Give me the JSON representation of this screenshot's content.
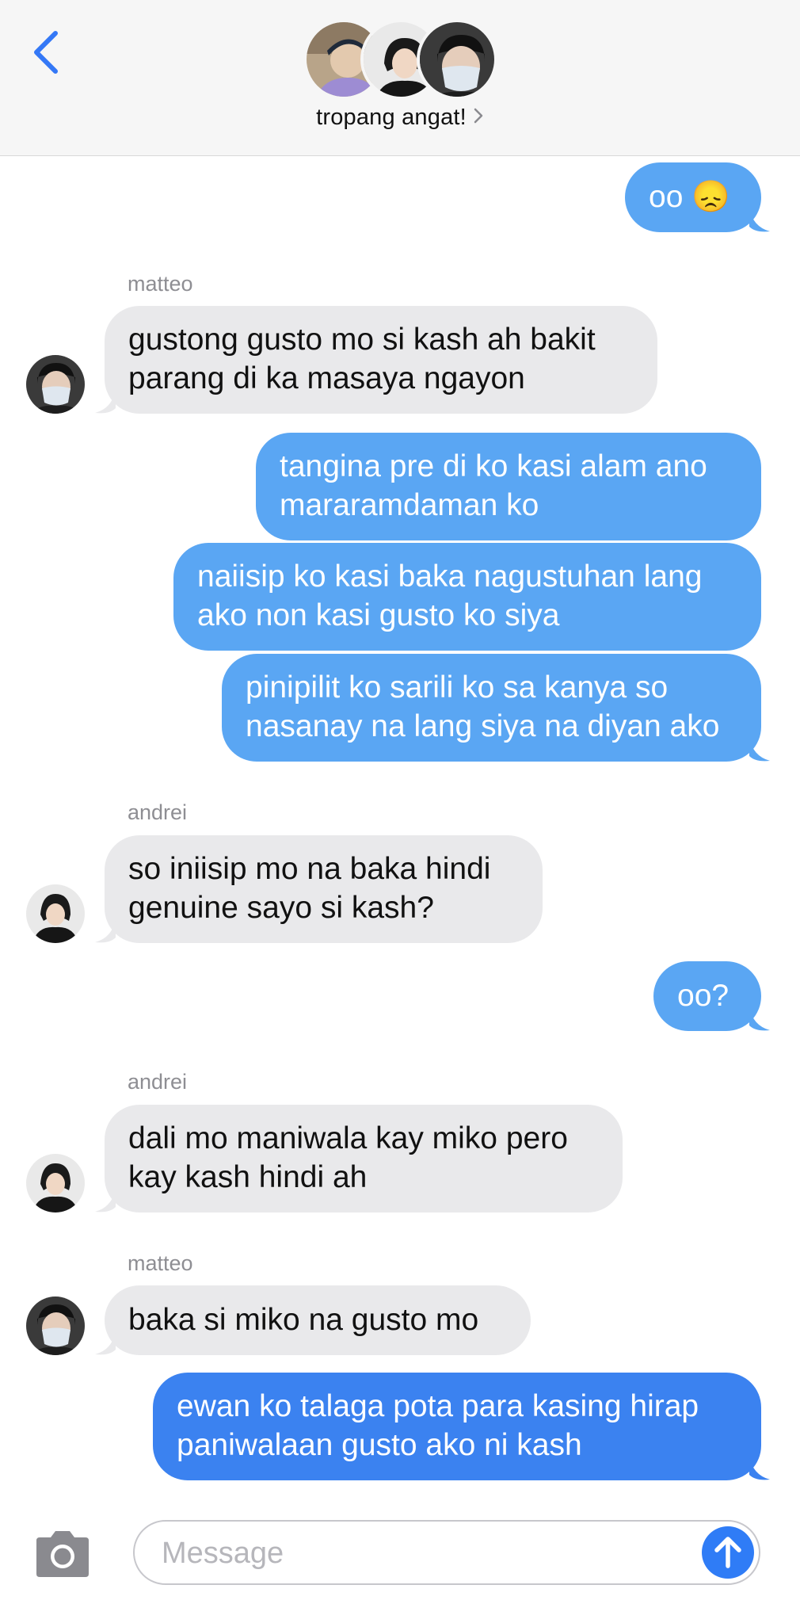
{
  "header": {
    "group_name": "tropang angat!",
    "back_icon": "chevron-left-icon",
    "accent": "#3478f6"
  },
  "messages": [
    {
      "dir": "out",
      "text": "oo 😞"
    },
    {
      "dir": "in",
      "sender": "matteo",
      "text": "gustong gusto mo si kash ah bakit\nparang di ka masaya ngayon"
    },
    {
      "dir": "out",
      "text": "tangina pre di ko kasi alam ano\nmararamdaman ko"
    },
    {
      "dir": "out",
      "text": "naiisip ko kasi baka nagustuhan lang\nako non kasi gusto ko siya"
    },
    {
      "dir": "out",
      "text": "pinipilit ko sarili ko sa kanya so\nnasanay na lang siya na diyan ako"
    },
    {
      "dir": "in",
      "sender": "andrei",
      "text": "so iniisip mo na baka hindi\ngenuine sayo si kash?"
    },
    {
      "dir": "out",
      "text": "oo?"
    },
    {
      "dir": "in",
      "sender": "andrei",
      "text": "dali mo maniwala kay miko pero\nkay kash hindi ah"
    },
    {
      "dir": "in",
      "sender": "matteo",
      "text": "baka si miko na gusto mo"
    },
    {
      "dir": "out",
      "text": "ewan ko talaga pota para kasing hirap\npaniwalaan gusto ako ni kash"
    }
  ],
  "composer": {
    "placeholder": "Message",
    "camera_icon": "camera-icon",
    "send_icon": "arrow-up-icon"
  },
  "colors": {
    "outgoing_bubble": "#5aa6f3",
    "outgoing_bubble_latest": "#3b82f0",
    "incoming_bubble": "#e9e9eb",
    "sender_label": "#8e8e93"
  }
}
